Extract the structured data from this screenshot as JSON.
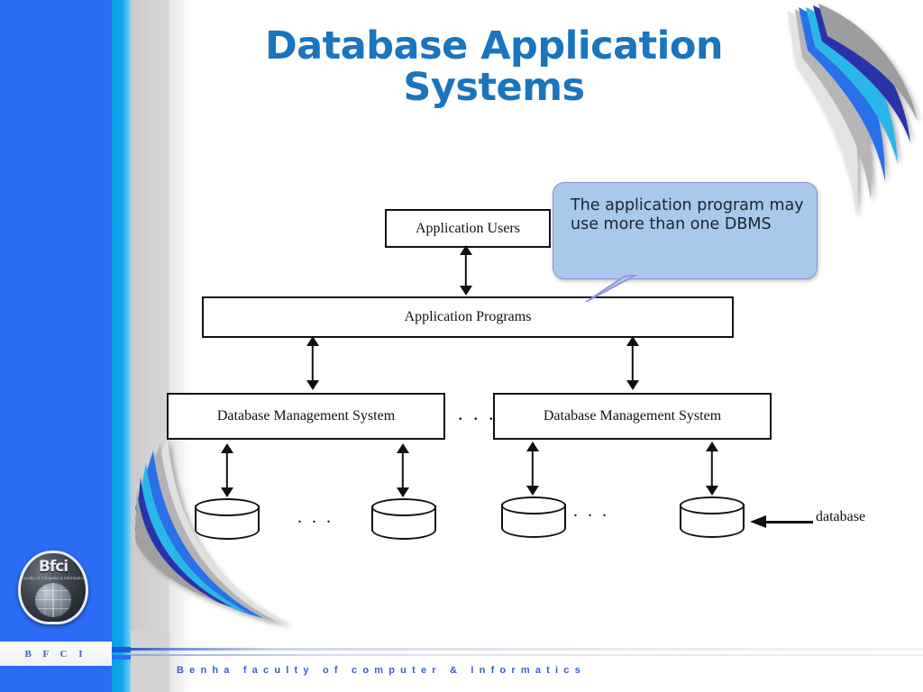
{
  "slide": {
    "title": "Database Application Systems",
    "title_color": "#1b74bd",
    "title_lines": [
      "Database Application",
      "Systems"
    ]
  },
  "branding": {
    "logo_word": "Bfci",
    "logo_sub": "Faculty of Computer & Informatics",
    "logo_icon": "globe-icon",
    "sidebar_label": "B F C I",
    "footer_text": "Benha  faculty  of  computer  &  Informatics",
    "blue": "#2a6cf5",
    "cyan": "#0ba0e8",
    "gray": "#d3d3d3",
    "footer_color": "#3a61c4"
  },
  "diagram": {
    "boxes": [
      {
        "id": "users",
        "label": "Application Users"
      },
      {
        "id": "programs",
        "label": "Application Programs"
      },
      {
        "id": "dbms_1",
        "label": "Database Management System"
      },
      {
        "id": "dbms_2",
        "label": "Database Management System"
      }
    ],
    "ellipsis": {
      "dbms": ". . .",
      "db_left": ". . .",
      "db_right": ". . ."
    },
    "databases": [
      {
        "id": "db_1",
        "shape": "cylinder"
      },
      {
        "id": "db_2",
        "shape": "cylinder"
      },
      {
        "id": "db_3",
        "shape": "cylinder"
      },
      {
        "id": "db_4",
        "shape": "cylinder"
      }
    ],
    "database_annotation": "database",
    "arrows": [
      {
        "id": "users_programs",
        "style": "double-headed-vertical"
      },
      {
        "id": "programs_dbms_1",
        "style": "double-headed-vertical"
      },
      {
        "id": "programs_dbms_2",
        "style": "double-headed-vertical"
      },
      {
        "id": "dbms1_db1",
        "style": "double-headed-vertical"
      },
      {
        "id": "dbms1_db2",
        "style": "double-headed-vertical"
      },
      {
        "id": "dbms2_db3",
        "style": "double-headed-vertical"
      },
      {
        "id": "dbms2_db4",
        "style": "double-headed-vertical"
      }
    ]
  },
  "callout": {
    "text": "The application program may use more than one DBMS",
    "fill": "#a9c8ea",
    "border": "#8e8ed8"
  },
  "decor": {
    "swoosh_colors": [
      "#b9b9b9",
      "#2b6fe8",
      "#29b6e8",
      "#2b31a8",
      "#d9d9d9"
    ]
  }
}
